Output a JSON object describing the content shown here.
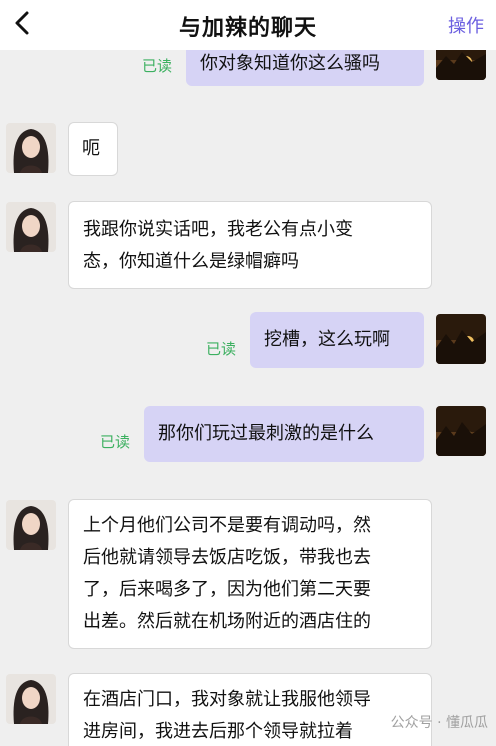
{
  "header": {
    "title": "与加辣的聊天",
    "action_label": "操作"
  },
  "messages": [
    {
      "from": "me",
      "read_label": "已读",
      "lines": [
        "你对象知道你这么骚吗"
      ]
    },
    {
      "from": "them",
      "lines": [
        "呃"
      ]
    },
    {
      "from": "them",
      "lines": [
        "我跟你说实话吧，我老公有点小变",
        "态，你知道什么是绿帽癖吗"
      ]
    },
    {
      "from": "me",
      "read_label": "已读",
      "lines": [
        "挖槽，这么玩啊"
      ]
    },
    {
      "from": "me",
      "read_label": "已读",
      "lines": [
        "那你们玩过最刺激的是什么"
      ]
    },
    {
      "from": "them",
      "lines": [
        "上个月他们公司不是要有调动吗，然",
        "后他就请领导去饭店吃饭，带我也去",
        "了，后来喝多了，因为他们第二天要",
        "出差。然后就在机场附近的酒店住的"
      ]
    },
    {
      "from": "them",
      "lines": [
        "在酒店门口，我对象就让我服他领导",
        "进房间，我进去后那个领导就拉着"
      ]
    }
  ],
  "watermark": "公众号 · 懂瓜瓜",
  "colors": {
    "accent": "#6b5fe0",
    "read": "#3cb060",
    "bubble_out": "#d6d3f5",
    "bubble_in": "#ffffff",
    "background": "#efefef"
  },
  "icons": {
    "back": "chevron-left-icon"
  }
}
